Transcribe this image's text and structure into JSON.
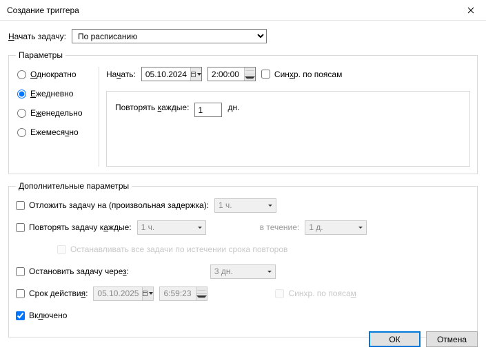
{
  "window": {
    "title": "Создание триггера"
  },
  "begin": {
    "label_prefix": "Н",
    "label_rest": "ачать задачу:",
    "selected": "По расписанию"
  },
  "params": {
    "legend": "Параметры",
    "radios": {
      "once_pre": "",
      "once_u": "О",
      "once_post": "днократно",
      "daily_pre": "",
      "daily_u": "Е",
      "daily_post": "жедневно",
      "weekly_pre": "Е",
      "weekly_u": "ж",
      "weekly_post": "енедельно",
      "monthly_pre": "Ежемеся",
      "monthly_u": "ч",
      "monthly_post": "но"
    },
    "start_label_pre": "На",
    "start_label_u": "ч",
    "start_label_post": "ать:",
    "start_date": "05.10.2024",
    "start_time": "2:00:00",
    "sync_pre": "Син",
    "sync_u": "х",
    "sync_post": "р. по поясам",
    "repeat_label_pre": "Повторять ",
    "repeat_label_u": "к",
    "repeat_label_post": "аждые:",
    "repeat_value": "1",
    "repeat_unit": "дн."
  },
  "adv": {
    "legend": "Дополнительные параметры",
    "delay_pre": "Отложить задачу на (произвольная задержка",
    "delay_u": ")",
    "delay_post": ":",
    "delay_label": "Отложить задачу на (произвольная задержка):",
    "delay_value": "1 ч.",
    "repeat_pre": "Повторять задачу к",
    "repeat_u": "а",
    "repeat_post": "ждые:",
    "repeat_value": "1 ч.",
    "duration_label": "в течение:",
    "duration_value": "1 д.",
    "stopall_label": "Останавливать все задачи по истечении срока повторов",
    "stopafter_pre": "Остановить задачу чере",
    "stopafter_u": "з",
    "stopafter_post": ":",
    "stopafter_value": "3 дн.",
    "expire_pre": "Срок действи",
    "expire_u": "я",
    "expire_post": ":",
    "expire_date": "05.10.2025",
    "expire_time": "6:59:23",
    "expire_sync_pre": "Синхр. по пояса",
    "expire_sync_u": "м",
    "expire_sync_post": "",
    "enabled_pre": "Вк",
    "enabled_u": "л",
    "enabled_post": "ючено"
  },
  "buttons": {
    "ok": "ОК",
    "cancel": "Отмена"
  }
}
